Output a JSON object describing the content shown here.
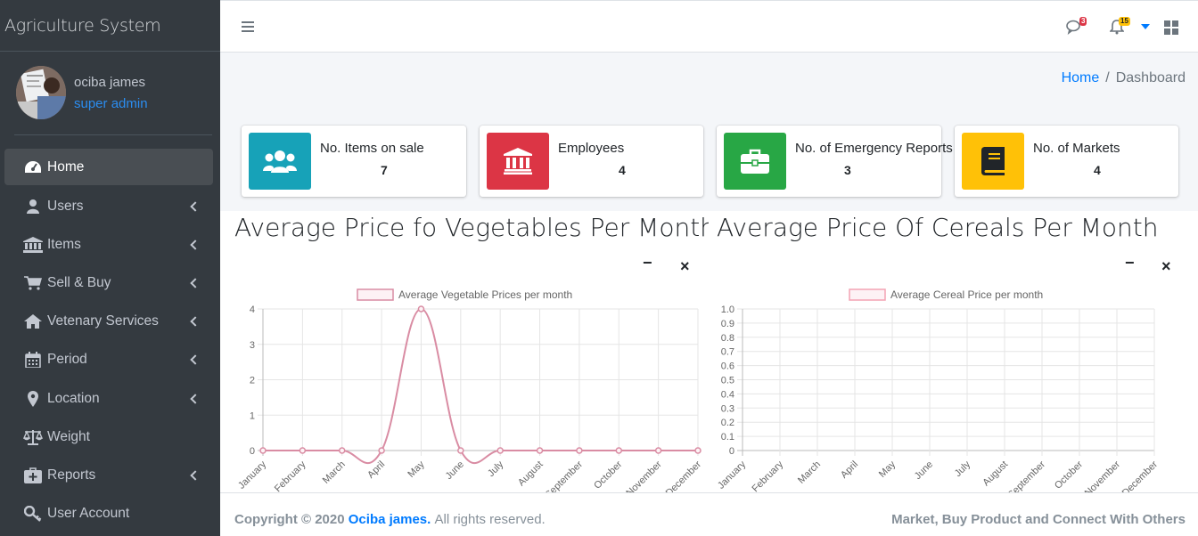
{
  "app": {
    "title": "Agriculture System"
  },
  "user": {
    "name": "ociba james",
    "role": "super admin"
  },
  "nav": [
    {
      "label": "Home",
      "icon": "dashboard-icon",
      "active": true,
      "expandable": false
    },
    {
      "label": "Users",
      "icon": "user-icon",
      "active": false,
      "expandable": true
    },
    {
      "label": "Items",
      "icon": "bank-icon",
      "active": false,
      "expandable": true
    },
    {
      "label": "Sell & Buy",
      "icon": "cart-icon",
      "active": false,
      "expandable": true
    },
    {
      "label": "Vetenary Services",
      "icon": "home-icon",
      "active": false,
      "expandable": true
    },
    {
      "label": "Period",
      "icon": "calendar-icon",
      "active": false,
      "expandable": true
    },
    {
      "label": "Location",
      "icon": "map-marker-icon",
      "active": false,
      "expandable": true
    },
    {
      "label": "Weight",
      "icon": "balance-scale-icon",
      "active": false,
      "expandable": false
    },
    {
      "label": "Reports",
      "icon": "medkit-icon",
      "active": false,
      "expandable": true
    },
    {
      "label": "User Account",
      "icon": "key-icon",
      "active": false,
      "expandable": false
    }
  ],
  "header": {
    "messages_badge": "3",
    "notifications_badge": "15",
    "colors": {
      "danger": "#dc3545",
      "warning": "#ffc107"
    }
  },
  "breadcrumb": {
    "home": "Home",
    "separator": "/",
    "current": "Dashboard"
  },
  "info_boxes": [
    {
      "label": "No. Items on sale",
      "value": "7",
      "icon": "users-icon",
      "color": "#17a2b8"
    },
    {
      "label": "Employees",
      "value": "4",
      "icon": "university-icon",
      "color": "#dc3545"
    },
    {
      "label": "No. of Emergency Reports",
      "value": "3",
      "icon": "briefcase-icon",
      "color": "#28a745"
    },
    {
      "label": "No. of Markets",
      "value": "4",
      "icon": "book-icon",
      "color": "#ffc107"
    }
  ],
  "cards": [
    {
      "title": "Average Price fo Vegetables Per Month",
      "minimize": "−",
      "close": "×"
    },
    {
      "title": "Average Price Of Cereals Per Month",
      "minimize": "−",
      "close": "×"
    }
  ],
  "chart_data": [
    {
      "type": "line",
      "title": "",
      "categories": [
        "January",
        "February",
        "March",
        "April",
        "May",
        "June",
        "July",
        "August",
        "September",
        "October",
        "November",
        "December"
      ],
      "series": [
        {
          "name": "Average Vegetable Prices per month",
          "values": [
            0,
            0,
            0,
            0,
            4,
            0,
            0,
            0,
            0,
            0,
            0,
            0
          ],
          "color": "#d98ca3"
        }
      ],
      "yticks": [
        "0",
        "1",
        "2",
        "3",
        "4"
      ],
      "ylim": [
        0,
        4
      ],
      "grid": true,
      "legend": "top-center"
    },
    {
      "type": "line",
      "title": "",
      "categories": [
        "January",
        "February",
        "March",
        "April",
        "May",
        "June",
        "July",
        "August",
        "September",
        "October",
        "November",
        "December"
      ],
      "series": [
        {
          "name": "Average Cereal Price per month",
          "values": [],
          "color": "#f4a3b4"
        }
      ],
      "yticks": [
        "0",
        "0.1",
        "0.2",
        "0.3",
        "0.4",
        "0.5",
        "0.6",
        "0.7",
        "0.8",
        "0.9",
        "1.0"
      ],
      "ylim": [
        0,
        1
      ],
      "grid": true,
      "legend": "top-center"
    }
  ],
  "footer": {
    "copyright_prefix": "Copyright © 2020",
    "author": "Ociba james.",
    "rights": "All rights reserved.",
    "tagline": "Market, Buy Product and Connect With Others"
  }
}
